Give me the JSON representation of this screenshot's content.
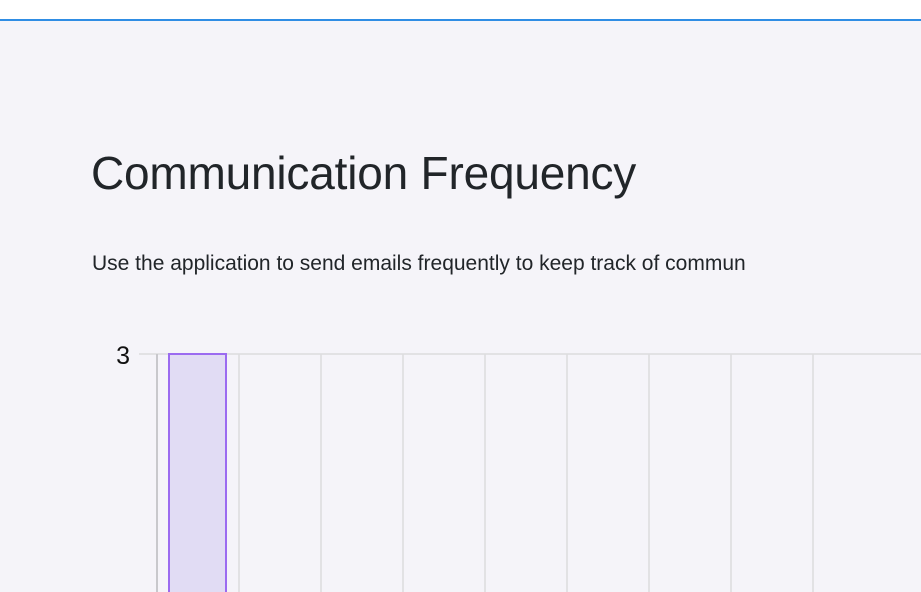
{
  "page": {
    "title": "Communication Frequency",
    "description": "Use the application to send emails frequently to keep track of commun"
  },
  "colors": {
    "accent_border": "#2f8de4",
    "background": "#f5f4f9",
    "bar_fill": "#e1dcf4",
    "bar_stroke": "#9b6bf0",
    "grid": "#dcdcde",
    "axis": "#c8c8cc",
    "text": "#212529"
  },
  "chart_data": {
    "type": "bar",
    "categories": [
      "",
      "",
      "",
      "",
      "",
      "",
      "",
      "",
      ""
    ],
    "values": [
      3,
      null,
      null,
      null,
      null,
      null,
      null,
      null,
      null
    ],
    "y_ticks": [
      "3"
    ],
    "ylim": [
      0,
      3
    ],
    "grid": true
  }
}
